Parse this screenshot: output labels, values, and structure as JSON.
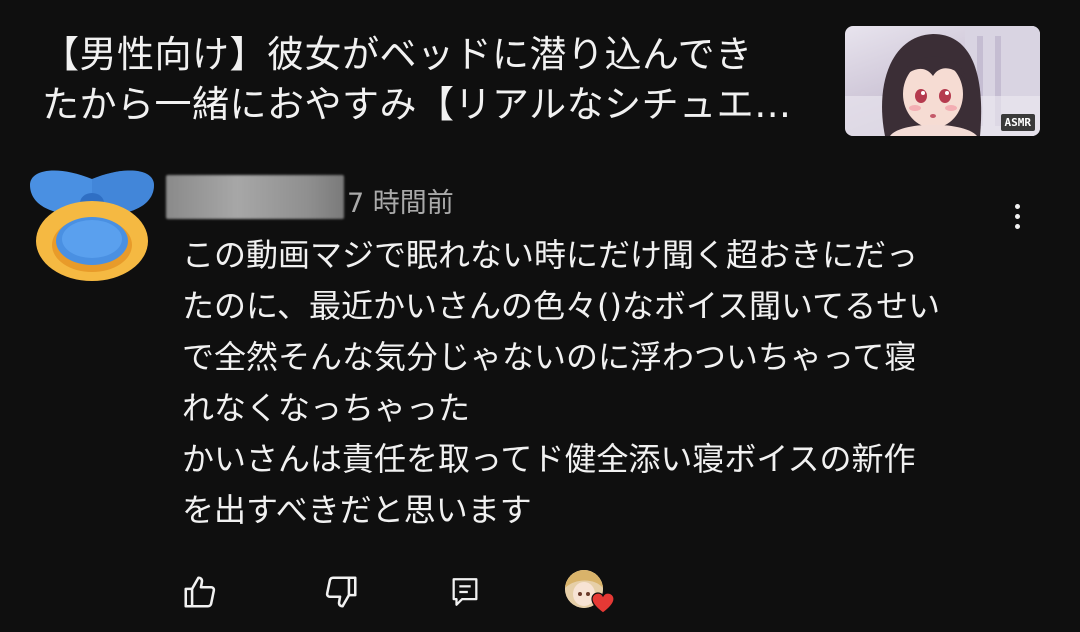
{
  "video": {
    "title_line1": "【男性向け】彼女がベッドに潜り込んでき",
    "title_line2": "たから一緒におやすみ【リアルなシチュエ…",
    "thumbnail_badge": "ASMR"
  },
  "comment": {
    "timestamp": "7 時間前",
    "lines": [
      "この動画マジで眠れない時にだけ聞く超おきにだっ",
      "たのに、最近かいさんの色々()なボイス聞いてるせい",
      "で全然そんな気分じゃないのに浮わついちゃって寝",
      "れなくなっちゃった",
      "かいさんは責任を取ってド健全添い寝ボイスの新作",
      "を出すべきだと思います"
    ]
  },
  "icons": {
    "avatar": "pacifier-avatar-icon",
    "more": "more-vert-icon",
    "like": "thumb-up-icon",
    "dislike": "thumb-down-icon",
    "reply": "comment-icon",
    "heart": "heart-icon"
  },
  "colors": {
    "background": "#0f0f0f",
    "text": "#f1f1f1",
    "secondary_text": "#aaaaaa",
    "avatar_blue": "#4a90e2",
    "avatar_yellow": "#f5b942",
    "heart_red": "#e53935"
  }
}
